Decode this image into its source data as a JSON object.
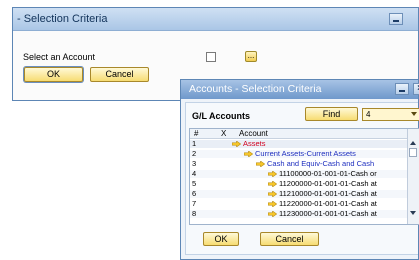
{
  "dialog1": {
    "title": "- Selection Criteria",
    "select_label": "Select an Account",
    "ok_label": "OK",
    "cancel_label": "Cancel"
  },
  "dialog2": {
    "title": "Accounts - Selection Criteria",
    "section_label": "G/L Accounts",
    "find_label": "Find",
    "find_value": "4",
    "columns": [
      "#",
      "X",
      "Account"
    ],
    "rows": [
      {
        "num": "1",
        "label": "Assets",
        "color": "#d1001f",
        "indent": 0
      },
      {
        "num": "2",
        "label": "Current Assets-Current Assets",
        "color": "#1f2fbf",
        "indent": 1
      },
      {
        "num": "3",
        "label": "Cash and Equiv-Cash and Cash",
        "color": "#1f2fbf",
        "indent": 2
      },
      {
        "num": "4",
        "label": "11100000-01-001-01-Cash or",
        "color": "#000000",
        "indent": 3
      },
      {
        "num": "5",
        "label": "11200000-01-001-01-Cash at",
        "color": "#000000",
        "indent": 3
      },
      {
        "num": "6",
        "label": "11210000-01-001-01-Cash at",
        "color": "#000000",
        "indent": 3
      },
      {
        "num": "7",
        "label": "11220000-01-001-01-Cash at",
        "color": "#000000",
        "indent": 3
      },
      {
        "num": "8",
        "label": "11230000-01-001-01-Cash at",
        "color": "#000000",
        "indent": 3
      }
    ],
    "ok_label": "OK",
    "cancel_label": "Cancel"
  },
  "colors": {
    "accent": "#f7dc72",
    "title_bar": "#6f98cb",
    "branch_text": "#1f2fbf",
    "root_text": "#d1001f"
  }
}
